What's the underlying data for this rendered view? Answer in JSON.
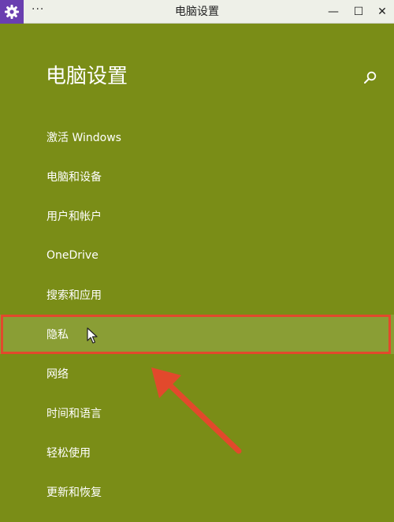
{
  "window": {
    "title": "电脑设置",
    "more_label": "···",
    "minimize_label": "—",
    "maximize_label": "☐",
    "close_label": "✕"
  },
  "page": {
    "title": "电脑设置"
  },
  "menu": {
    "items": [
      {
        "label": "激活 Windows"
      },
      {
        "label": "电脑和设备"
      },
      {
        "label": "用户和帐户"
      },
      {
        "label": "OneDrive"
      },
      {
        "label": "搜索和应用"
      },
      {
        "label": "隐私"
      },
      {
        "label": "网络"
      },
      {
        "label": "时间和语言"
      },
      {
        "label": "轻松使用"
      },
      {
        "label": "更新和恢复"
      }
    ],
    "highlighted_index": 5
  },
  "colors": {
    "background": "#7a8d17",
    "highlight_row": "#8a9e35",
    "annotation_red": "#e2492c",
    "app_icon": "#6a3fb0",
    "titlebar": "#eef0e8"
  },
  "icons": {
    "app": "gear-icon",
    "search": "search-icon",
    "cursor": "mouse-pointer-icon",
    "annotation": "red-arrow-annotation"
  }
}
